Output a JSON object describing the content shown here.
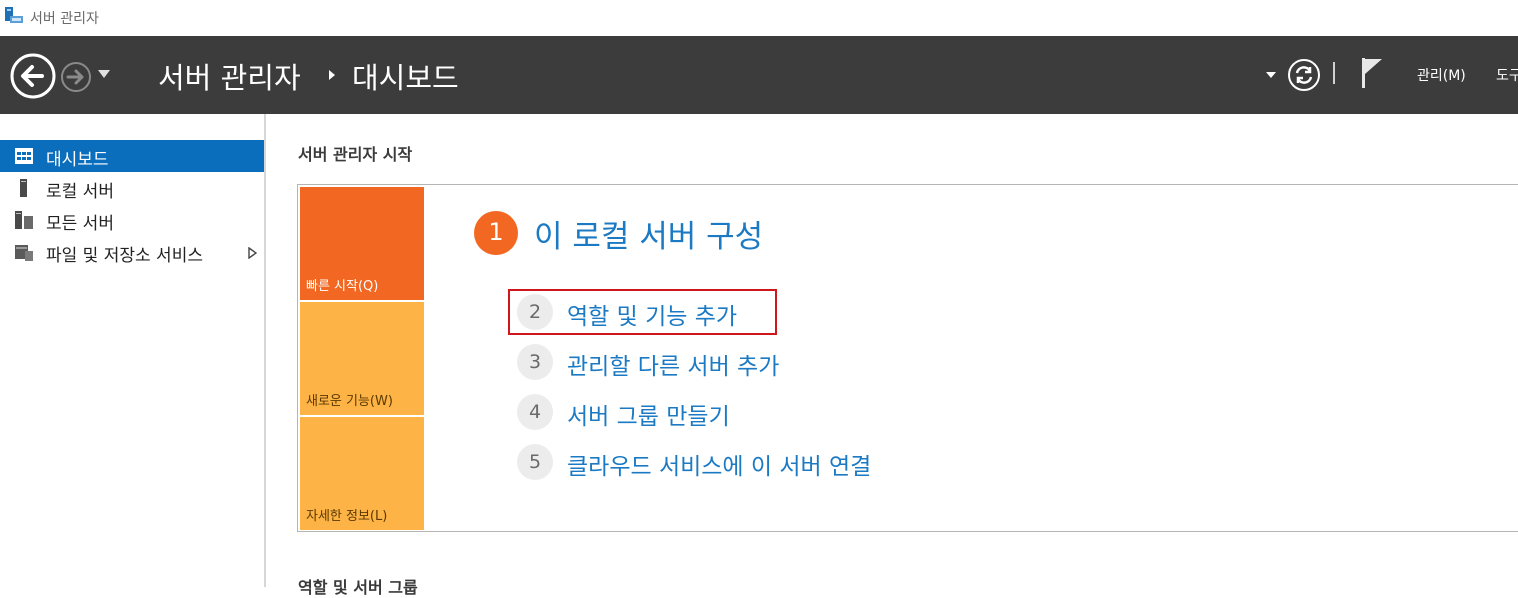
{
  "window": {
    "title": "서버 관리자"
  },
  "header": {
    "breadcrumb_root": "서버 관리자",
    "breadcrumb_page": "대시보드",
    "menu_manage": "관리(M)",
    "menu_tools": "도구"
  },
  "sidebar": {
    "items": [
      {
        "label": "대시보드",
        "icon": "dashboard-icon",
        "active": true
      },
      {
        "label": "로컬 서버",
        "icon": "local-server-icon",
        "active": false
      },
      {
        "label": "모든 서버",
        "icon": "all-servers-icon",
        "active": false
      },
      {
        "label": "파일 및 저장소 서비스",
        "icon": "file-storage-icon",
        "active": false,
        "has_submenu": true
      }
    ]
  },
  "main": {
    "welcome_title": "서버 관리자 시작",
    "tiles": [
      {
        "label": "빠른 시작(Q)",
        "color": "#f26722"
      },
      {
        "label": "새로운 기능(W)",
        "color": "#fdb345"
      },
      {
        "label": "자세한 정보(L)",
        "color": "#fdb345"
      }
    ],
    "primary_step": {
      "number": "1",
      "text": "이 로컬 서버 구성"
    },
    "steps": [
      {
        "number": "2",
        "text": "역할 및 기능 추가",
        "highlighted": true
      },
      {
        "number": "3",
        "text": "관리할 다른 서버 추가"
      },
      {
        "number": "4",
        "text": "서버 그룹 만들기"
      },
      {
        "number": "5",
        "text": "클라우드 서비스에 이 서버 연결"
      }
    ],
    "roles_title": "역할 및 서버 그룹"
  },
  "colors": {
    "header_bg": "#3c3c3c",
    "accent_blue": "#0a6ebd",
    "link_blue": "#1b7ac3",
    "tile_orange": "#f26722",
    "tile_yellow": "#fdb345",
    "highlight_red": "#d0161d"
  }
}
